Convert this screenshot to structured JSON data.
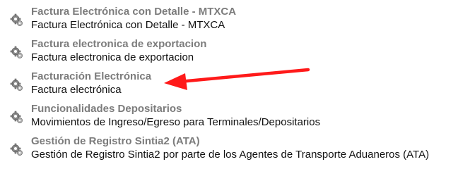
{
  "services": [
    {
      "title": "Factura Electrónica con Detalle - MTXCA",
      "description": "Factura Electrónica con Detalle - MTXCA"
    },
    {
      "title": "Factura electronica de exportacion",
      "description": "Factura electronica de exportacion"
    },
    {
      "title": "Facturación Electrónica",
      "description": "Factura electrónica"
    },
    {
      "title": "Funcionalidades Depositarios",
      "description": "Movimientos de Ingreso/Egreso para Terminales/Depositarios"
    },
    {
      "title": "Gestión de Registro Sintia2 (ATA)",
      "description": "Gestión de Registro Sintia2 por parte de los Agentes de Transporte Aduaneros (ATA)"
    }
  ],
  "icons": {
    "service": "gear-icon",
    "annotation": "red-arrow-icon"
  },
  "colors": {
    "title": "#7c7c7c",
    "description": "#111111",
    "arrow": "#ff1a1a"
  }
}
